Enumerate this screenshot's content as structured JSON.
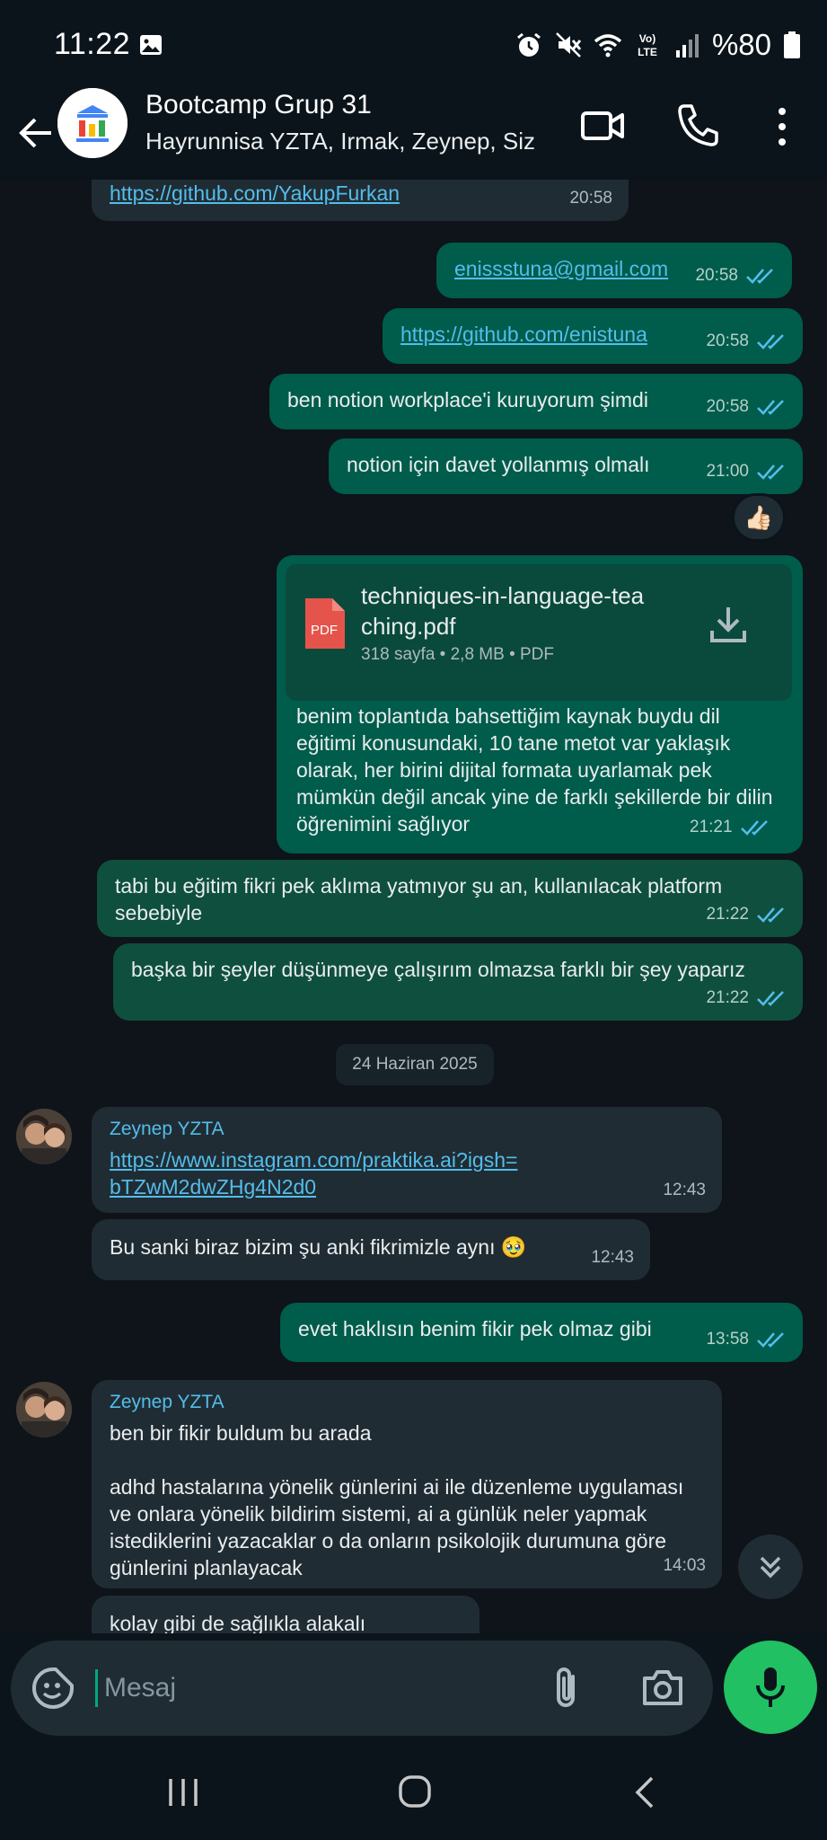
{
  "status_bar": {
    "time": "11:22",
    "battery": "%80",
    "icons": [
      "gallery-icon",
      "alarm-icon",
      "mute-icon",
      "wifi-icon",
      "volte-icon",
      "signal-icon",
      "battery-icon"
    ],
    "volte_label": "Vo) LTE"
  },
  "header": {
    "title": "Bootcamp Grup 31",
    "members": "Hayrunnisa YZTA, Irmak, Zeynep, Siz"
  },
  "messages": [
    {
      "dir": "in",
      "link": "https://github.com/YakupFurkan",
      "time": "20:58"
    },
    {
      "dir": "out",
      "link": "enissstuna@gmail.com",
      "time": "20:58"
    },
    {
      "dir": "out",
      "link": "https://github.com/enistuna",
      "time": "20:58"
    },
    {
      "dir": "out",
      "text": "ben notion workplace'i kuruyorum şimdi",
      "time": "20:58"
    },
    {
      "dir": "out",
      "text": "notion için davet yollanmış olmalı",
      "time": "21:00",
      "reaction": "👍🏻"
    },
    {
      "dir": "out",
      "file": {
        "name": "techniques-in-language-teaching.pdf",
        "name_line1": "techniques-in-language-tea",
        "name_line2": "ching.pdf",
        "info": "318 sayfa • 2,8 MB • PDF",
        "icon_label": "PDF"
      },
      "text": "benim toplantıda bahsettiğim kaynak buydu dil eğitimi konusundaki, 10 tane metot var yaklaşık olarak, her birini dijital formata uyarlamak pek mümkün değil ancak yine de farklı şekillerde bir dilin öğrenimini sağlıyor",
      "time": "21:21"
    },
    {
      "dir": "out",
      "text": "tabi bu eğitim fikri pek aklıma yatmıyor şu an, kullanılacak platform sebebiyle",
      "time": "21:22"
    },
    {
      "dir": "out",
      "text": "başka bir şeyler düşünmeye çalışırım olmazsa farklı bir şey yaparız",
      "time": "21:22"
    },
    {
      "dir": "in",
      "sender": "Zeynep YZTA",
      "link": "https://www.instagram.com/praktika.ai?igsh=bTZwM2dwZHg4N2d0",
      "link_line1": "https://www.instagram.com/praktika.ai?igsh=",
      "link_line2": "bTZwM2dwZHg4N2d0",
      "time": "12:43"
    },
    {
      "dir": "in",
      "text": "Bu sanki biraz bizim şu anki fikrimizle aynı 🥹",
      "time": "12:43"
    },
    {
      "dir": "out",
      "text": "evet haklısın benim fikir pek olmaz gibi",
      "time": "13:58"
    },
    {
      "dir": "in",
      "sender": "Zeynep YZTA",
      "text": "ben bir fikir buldum bu arada",
      "text2": "adhd hastalarına yönelik günlerini ai ile düzenleme uygulaması ve onlara yönelik bildirim sistemi, ai a günlük neler yapmak istediklerini yazacaklar o da onların psikolojik durumuna göre günlerini planlayacak",
      "time": "14:03"
    },
    {
      "dir": "in",
      "text": "kolay gibi de sağlıkla alakalı"
    }
  ],
  "date_divider": "24 Haziran 2025",
  "composer": {
    "placeholder": "Mesaj"
  },
  "colors": {
    "background": "#0b141a",
    "incoming_bubble": "#202c33",
    "outgoing_bubble": "#005c4b",
    "link": "#53bdeb",
    "read_ticks": "#53bdeb",
    "mic_button": "#21c063"
  }
}
